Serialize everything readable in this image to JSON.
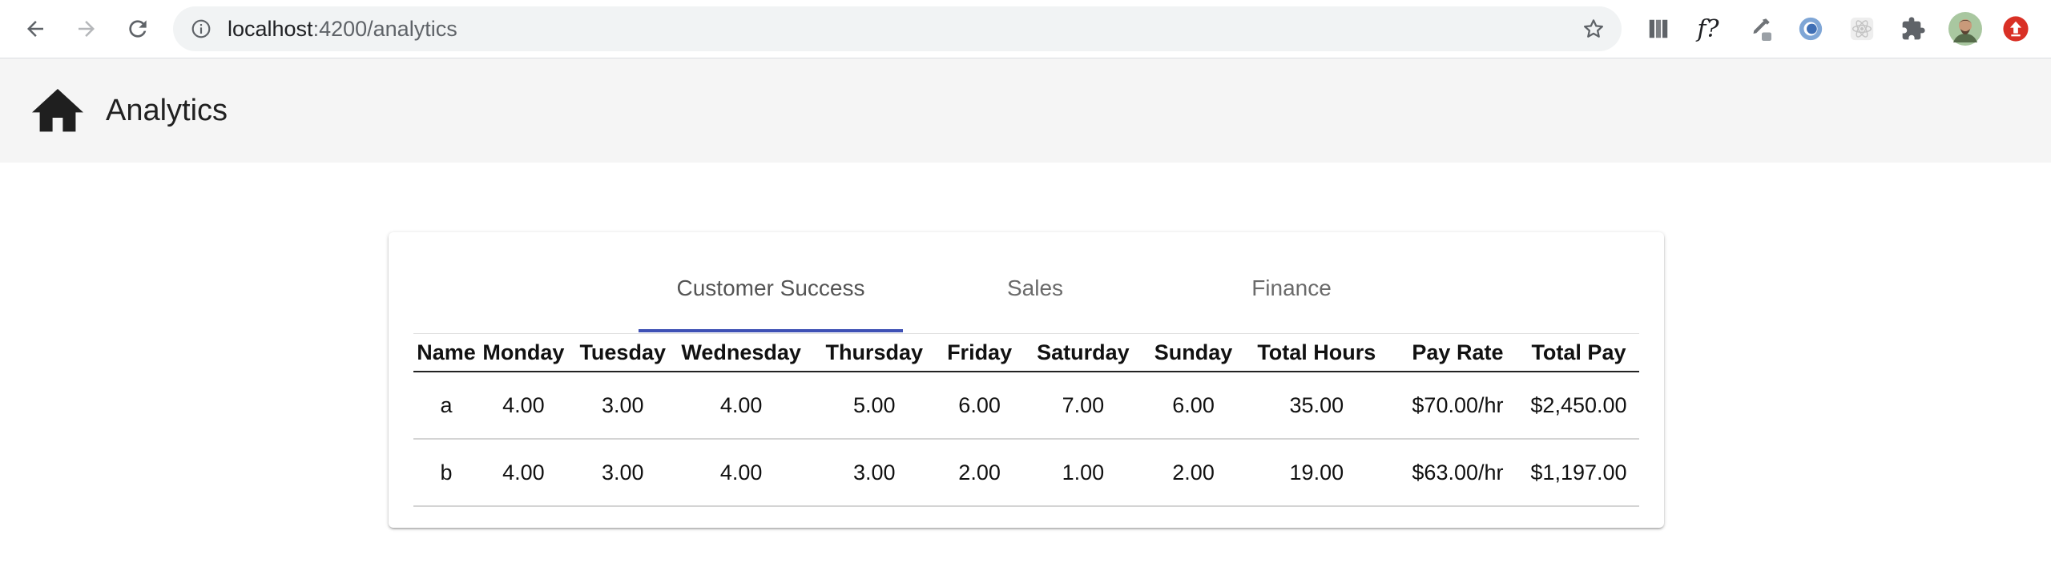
{
  "browser": {
    "url_host": "localhost",
    "url_path": ":4200/analytics",
    "extensions": [
      "books-icon",
      "fx-icon",
      "eyedropper-icon",
      "circle-extension-icon",
      "react-icon",
      "puzzle-icon",
      "avatar",
      "upload-icon"
    ],
    "fx_label": "f?"
  },
  "app": {
    "title": "Analytics"
  },
  "tabs": [
    {
      "label": "Customer Success",
      "active": true
    },
    {
      "label": "Sales",
      "active": false
    },
    {
      "label": "Finance",
      "active": false
    }
  ],
  "table": {
    "headers": [
      "Name",
      "Monday",
      "Tuesday",
      "Wednesday",
      "Thursday",
      "Friday",
      "Saturday",
      "Sunday",
      "Total Hours",
      "Pay Rate",
      "Total Pay"
    ],
    "rows": [
      [
        "a",
        "4.00",
        "3.00",
        "4.00",
        "5.00",
        "6.00",
        "7.00",
        "6.00",
        "35.00",
        "$70.00/hr",
        "$2,450.00"
      ],
      [
        "b",
        "4.00",
        "3.00",
        "4.00",
        "3.00",
        "2.00",
        "1.00",
        "2.00",
        "19.00",
        "$63.00/hr",
        "$1,197.00"
      ]
    ]
  },
  "colors": {
    "tab_ink": "#3f51b5",
    "toolbar_bg": "#f5f5f5",
    "upload_badge": "#d93025"
  }
}
